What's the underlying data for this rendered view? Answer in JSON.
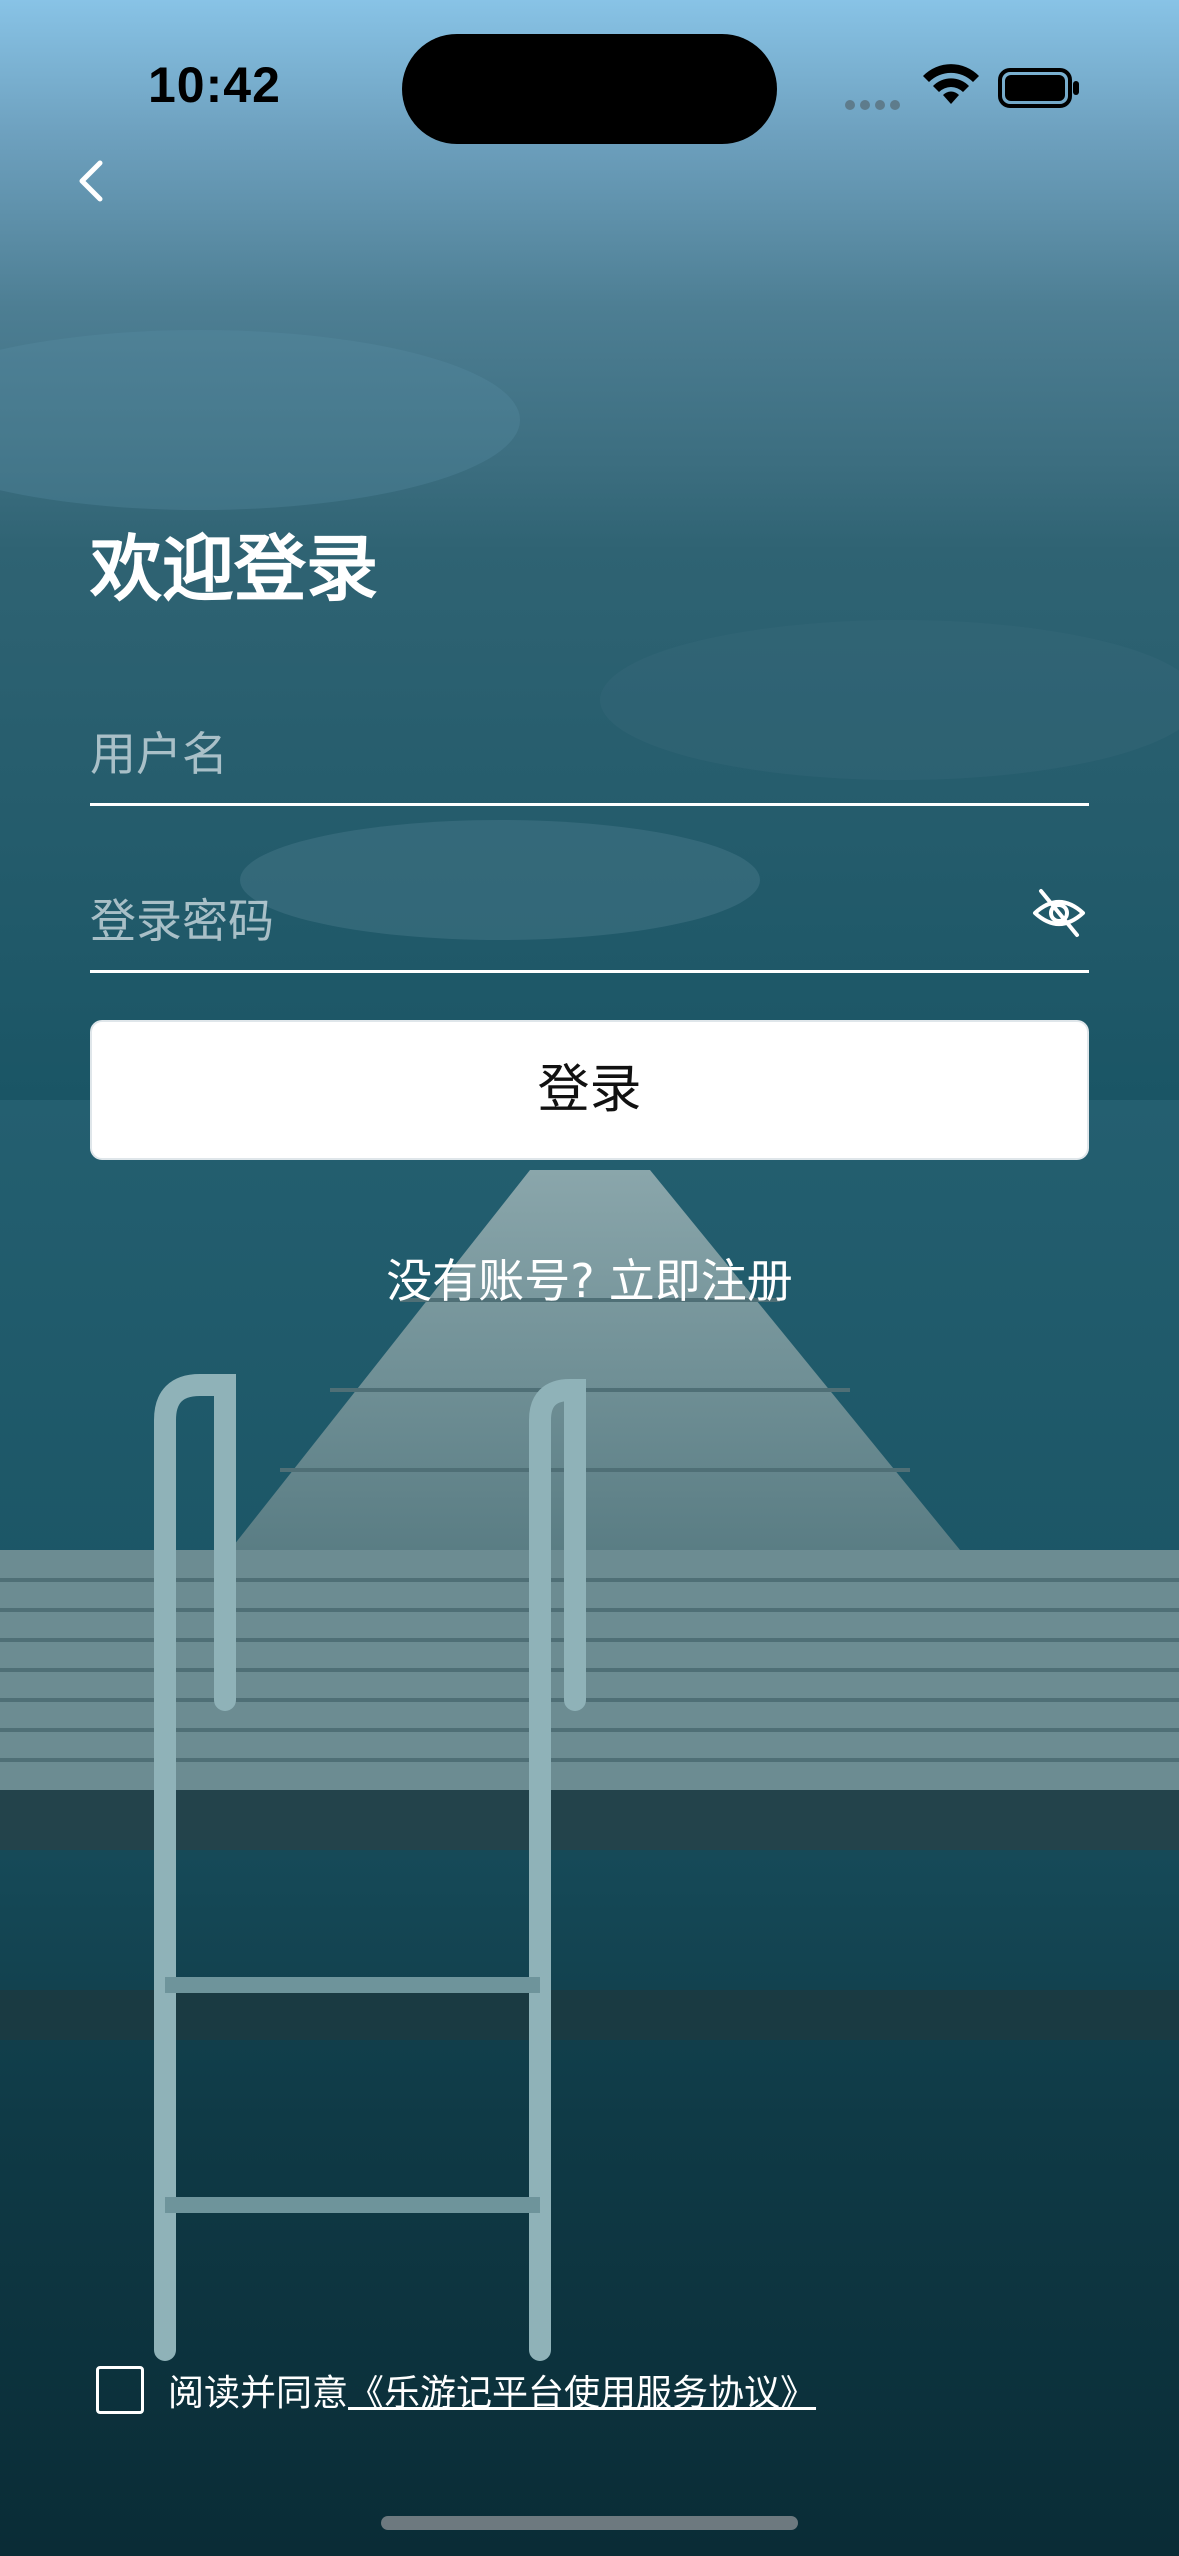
{
  "status_bar": {
    "time": "10:42"
  },
  "header": {
    "back_icon": "chevron-left-icon"
  },
  "login": {
    "title": "欢迎登录",
    "username_placeholder": "用户名",
    "password_placeholder": "登录密码",
    "password_toggle_icon": "eye-off-icon",
    "submit_label": "登录",
    "no_account_text": "没有账号?",
    "register_link": "立即注册"
  },
  "agreement": {
    "prefix": "阅读并同意",
    "link": "《乐游记平台使用服务协议》"
  },
  "colors": {
    "button_bg": "#ffffff",
    "text": "#ffffff",
    "sky_top": "#86bfe2",
    "sea": "#1e6374"
  }
}
